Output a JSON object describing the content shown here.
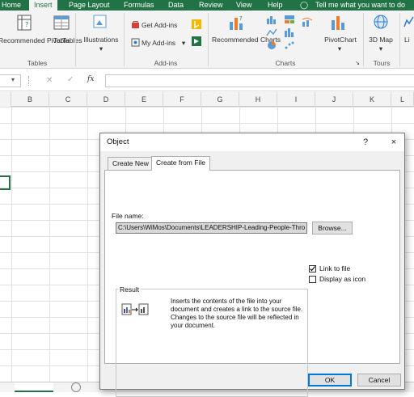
{
  "tabs": [
    "Home",
    "Insert",
    "Page Layout",
    "Formulas",
    "Data",
    "Review",
    "View",
    "Help",
    "Tell me what you want to do"
  ],
  "ribbon": {
    "recommended_pivot_tables": "Recommended PivotTables",
    "table": "Table",
    "tables_group": "Tables",
    "illustrations": "Illustrations",
    "get_addins": "Get Add-ins",
    "my_addins": "My Add-ins",
    "addins_group": "Add-ins",
    "recommended_charts": "Recommended Charts",
    "pivot_chart": "PivotChart",
    "charts_group": "Charts",
    "map_3d": "3D Map",
    "tours_group": "Tours",
    "li": "Li"
  },
  "formula_bar": {
    "fx": "fx"
  },
  "columns": [
    "B",
    "C",
    "D",
    "E",
    "F",
    "G",
    "H",
    "I",
    "J",
    "K",
    "L"
  ],
  "dialog": {
    "title": "Object",
    "help": "?",
    "close": "×",
    "tabs": [
      "Create New",
      "Create from File"
    ],
    "active_tab": "Create from File",
    "file_name_label": "File name:",
    "file_name_value": "C:\\Users\\WiMos\\Documents\\LEADERSHIP-Leading-People-Thro",
    "browse_button": "Browse...",
    "link_to_file": "Link to file",
    "link_to_file_checked": true,
    "display_as_icon": "Display as icon",
    "display_as_icon_checked": false,
    "result_label": "Result",
    "result_text": "Inserts the contents of the file into your document and creates a link to the source file. Changes to the source file will be reflected in your document.",
    "ok_button": "OK",
    "cancel_button": "Cancel"
  },
  "colors": {
    "excel_green": "#217346",
    "ribbon_bg": "#f3f3f3",
    "dialog_bg": "#f0f0f0"
  }
}
